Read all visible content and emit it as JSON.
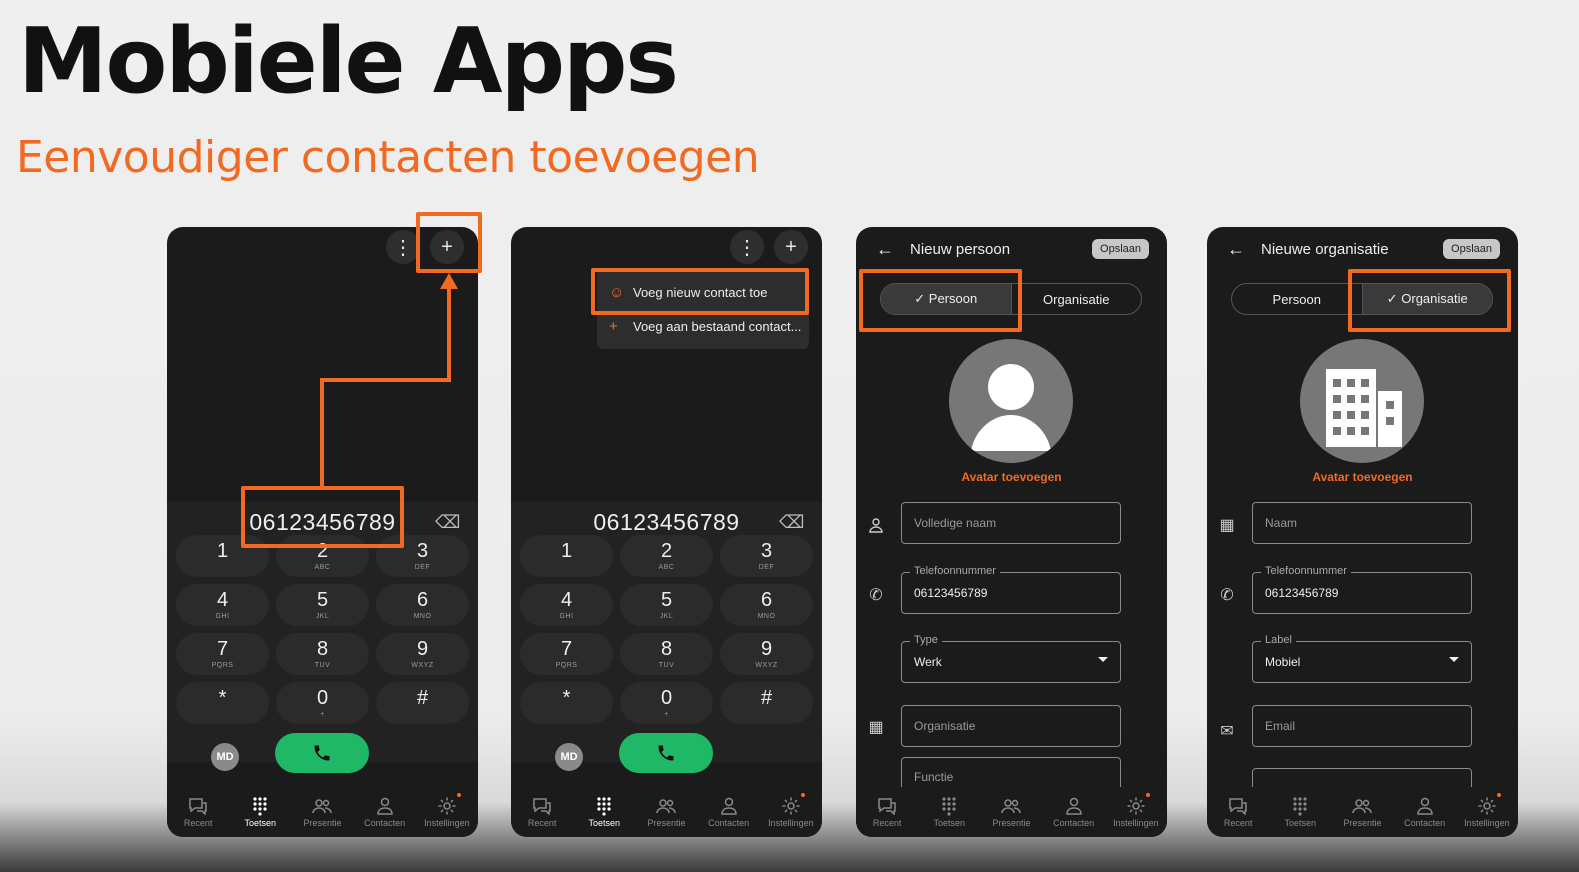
{
  "slide": {
    "title": "Mobiele Apps",
    "subtitle": "Eenvoudiger contacten toevoegen"
  },
  "dialer": {
    "number": "06123456789",
    "keys": [
      {
        "digit": "1",
        "letters": ""
      },
      {
        "digit": "2",
        "letters": "ABC"
      },
      {
        "digit": "3",
        "letters": "DEF"
      },
      {
        "digit": "4",
        "letters": "GHI"
      },
      {
        "digit": "5",
        "letters": "JKL"
      },
      {
        "digit": "6",
        "letters": "MNO"
      },
      {
        "digit": "7",
        "letters": "PQRS"
      },
      {
        "digit": "8",
        "letters": "TUV"
      },
      {
        "digit": "9",
        "letters": "WXYZ"
      },
      {
        "digit": "*",
        "letters": ""
      },
      {
        "digit": "0",
        "letters": "+"
      },
      {
        "digit": "#",
        "letters": ""
      }
    ],
    "user_initials": "MD"
  },
  "menu": {
    "add_new_contact": "Voeg nieuw contact toe",
    "add_to_existing": "Voeg aan bestaand contact..."
  },
  "nav": [
    {
      "label": "Recent",
      "icon": "chat-icon"
    },
    {
      "label": "Toetsen",
      "icon": "dialpad-icon"
    },
    {
      "label": "Presentie",
      "icon": "presence-icon"
    },
    {
      "label": "Contacten",
      "icon": "contact-icon"
    },
    {
      "label": "Instellingen",
      "icon": "gear-icon"
    }
  ],
  "person_form": {
    "title": "Nieuw persoon",
    "save": "Opslaan",
    "tab_person": "✓  Persoon",
    "tab_org": "Organisatie",
    "avatar_link": "Avatar toevoegen",
    "name_placeholder": "Volledige naam",
    "phone_label": "Telefoonnummer",
    "phone_value": "06123456789",
    "type_label": "Type",
    "type_value": "Werk",
    "org_placeholder": "Organisatie",
    "function_placeholder": "Functie"
  },
  "org_form": {
    "title": "Nieuwe organisatie",
    "save": "Opslaan",
    "tab_person": "Persoon",
    "tab_org": "✓  Organisatie",
    "avatar_link": "Avatar toevoegen",
    "name_placeholder": "Naam",
    "phone_label": "Telefoonnummer",
    "phone_value": "06123456789",
    "label_label": "Label",
    "label_value": "Mobiel",
    "email_placeholder": "Email"
  },
  "colors": {
    "accent": "#f26a21",
    "call_green": "#1fb866",
    "phone_bg": "#1b1b1b"
  }
}
